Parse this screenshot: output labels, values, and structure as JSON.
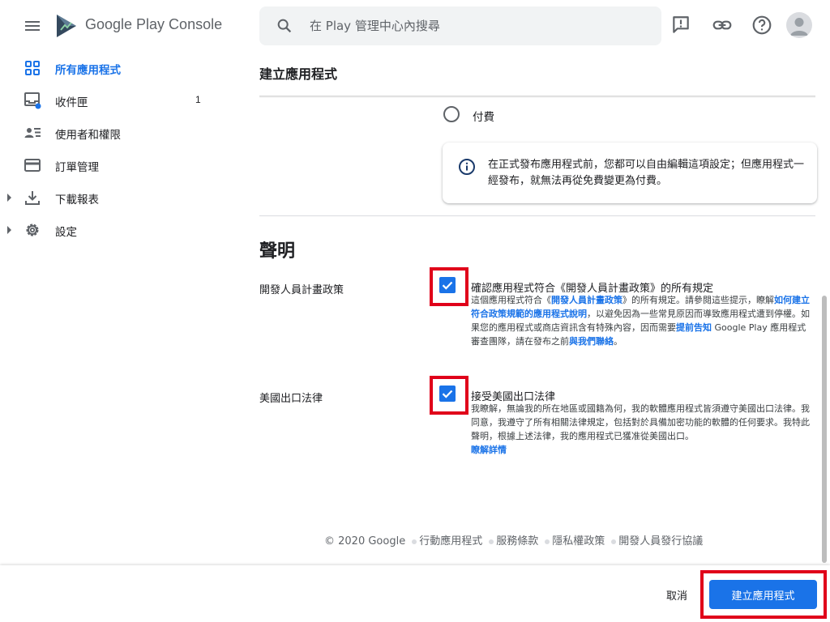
{
  "header": {
    "app_name": "Google Play Console",
    "search_placeholder": "在 Play 管理中心內搜尋"
  },
  "sidebar": {
    "items": [
      {
        "label": "所有應用程式",
        "active": true
      },
      {
        "label": "收件匣",
        "count": "1"
      },
      {
        "label": "使用者和權限"
      },
      {
        "label": "訂單管理"
      },
      {
        "label": "下載報表",
        "expandable": true
      },
      {
        "label": "設定",
        "expandable": true
      }
    ]
  },
  "main": {
    "title": "建立應用程式",
    "pricing_option": "付費",
    "info_text": "在正式發布應用程式前，您都可以自由編輯這項設定；但應用程式一經發布，就無法再從免費變更為付費。",
    "declarations_title": "聲明",
    "declarations": [
      {
        "row_label": "開發人員計畫政策",
        "checked": true,
        "title": "確認應用程式符合《開發人員計畫政策》的所有規定",
        "desc_1": "這個應用程式符合《",
        "link_1": "開發人員計畫政策",
        "desc_2": "》的所有規定。請參閱這些提示，瞭解",
        "link_2": "如何建立符合政策規範的應用程式說明",
        "desc_3": "，以避免因為一些常見原因而導致應用程式遭到停權。如果您的應用程式或商店資訊含有特殊內容，因而需要",
        "link_3": "提前告知",
        "desc_4": " Google Play 應用程式審查團隊，請在發布之前",
        "link_4": "與我們聯絡",
        "desc_5": "。"
      },
      {
        "row_label": "美國出口法律",
        "checked": true,
        "title": "接受美國出口法律",
        "desc_1": "我瞭解，無論我的所在地區或國籍為何，我的軟體應用程式皆須遵守美國出口法律。我同意，我遵守了所有相關法律規定，包括對於具備加密功能的軟體的任何要求。我特此聲明，根據上述法律，我的應用程式已獲准從美國出口。",
        "link_1": "瞭解詳情"
      }
    ]
  },
  "footer": {
    "copyright": "© 2020 Google",
    "links": [
      "行動應用程式",
      "服務條款",
      "隱私權政策",
      "開發人員發行協議"
    ]
  },
  "actions": {
    "cancel": "取消",
    "create": "建立應用程式"
  },
  "colors": {
    "accent": "#1a73e8",
    "highlight": "#e0001a"
  }
}
